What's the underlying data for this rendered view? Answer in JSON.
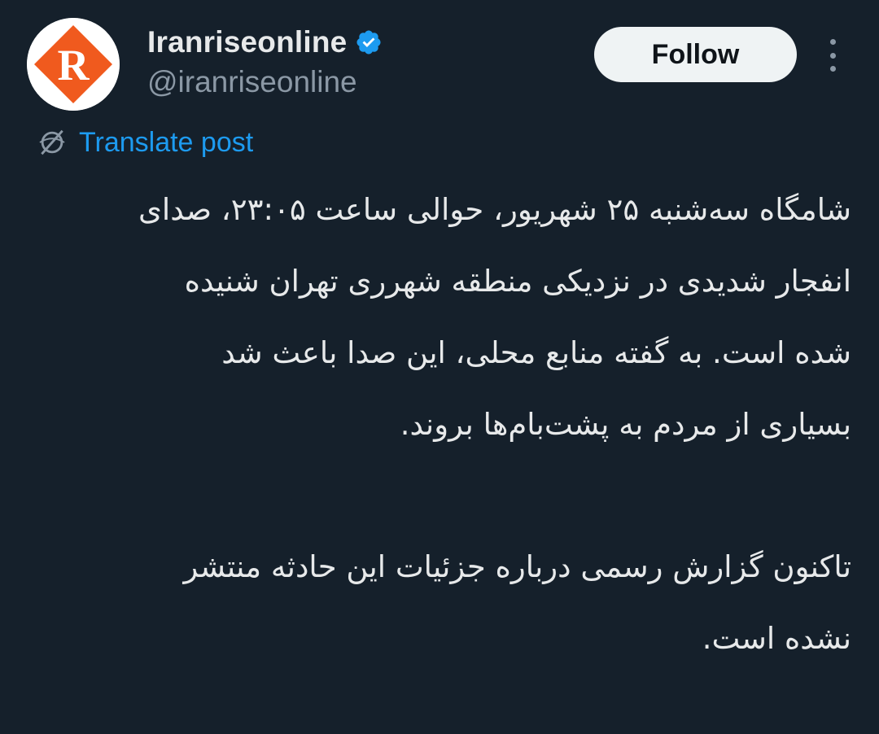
{
  "user": {
    "display_name": "Iranriseonline",
    "handle": "@iranriseonline",
    "avatar_letter": "R",
    "verified": true,
    "avatar_color": "#f05a1e"
  },
  "actions": {
    "follow_label": "Follow",
    "more_icon": "more-vertical-icon"
  },
  "translate": {
    "label": "Translate post",
    "icon": "globe-icon",
    "color": "#1d9bf0"
  },
  "post": {
    "paragraph1_lines": [
      "شامگاه سه‌شنبه ۲۵ شهریور، حوالی ساعت ۲۳:۰۵، صدای",
      "انفجار شدیدی در نزدیکی منطقه شهرری تهران شنیده",
      "شده است. به گفته منابع محلی، این صدا باعث شد",
      "بسیاری از مردم به پشت‌بام‌ها بروند."
    ],
    "paragraph2_lines": [
      "تاکنون گزارش رسمی درباره جزئیات این حادثه منتشر",
      "نشده است."
    ]
  },
  "colors": {
    "background": "#15202b",
    "text": "#e7e9ea",
    "secondary_text": "#8b98a5",
    "verified_badge": "#1d9bf0"
  }
}
